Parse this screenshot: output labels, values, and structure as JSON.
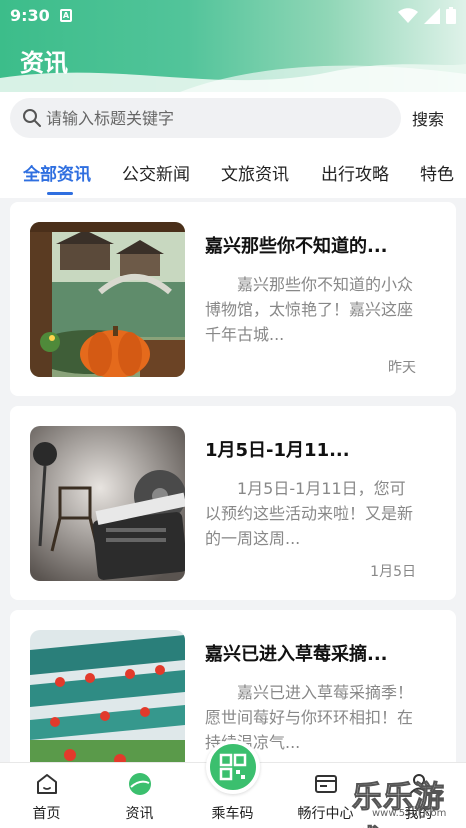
{
  "status": {
    "time": "9:30",
    "sim": "A"
  },
  "header": {
    "title": "资讯"
  },
  "search": {
    "placeholder": "请输入标题关键字",
    "button": "搜索"
  },
  "tabs": [
    {
      "label": "全部资讯",
      "active": true
    },
    {
      "label": "公交新闻"
    },
    {
      "label": "文旅资讯"
    },
    {
      "label": "出行攻略"
    },
    {
      "label": "特色"
    }
  ],
  "articles": [
    {
      "title": "嘉兴那些你不知道的...",
      "summary": "嘉兴那些你不知道的小众博物馆，太惊艳了！嘉兴这座千年古城...",
      "date": "昨天"
    },
    {
      "title": "1月5日-1月11...",
      "summary": "1月5日-1月11日，您可以预约这些活动来啦！又是新的一周这周...",
      "date": "1月5日"
    },
    {
      "title": "嘉兴已进入草莓采摘...",
      "summary": "嘉兴已进入草莓采摘季！愿世间莓好与你环环相扣！在持续温凉气...",
      "date": ""
    }
  ],
  "nav": [
    {
      "label": "首页",
      "icon": "home-icon"
    },
    {
      "label": "资讯",
      "icon": "news-icon",
      "active": true
    },
    {
      "label": "乘车码",
      "icon": "qr-code-icon"
    },
    {
      "label": "畅行中心",
      "icon": "card-icon"
    },
    {
      "label": "我的",
      "icon": "user-icon"
    }
  ],
  "watermark": {
    "text": "乐乐游戏",
    "sub": "www.55dt.com"
  },
  "colors": {
    "accent": "#2f6fe0",
    "header_green": "#3cbd8a",
    "qr_green": "#3bbf6e"
  }
}
